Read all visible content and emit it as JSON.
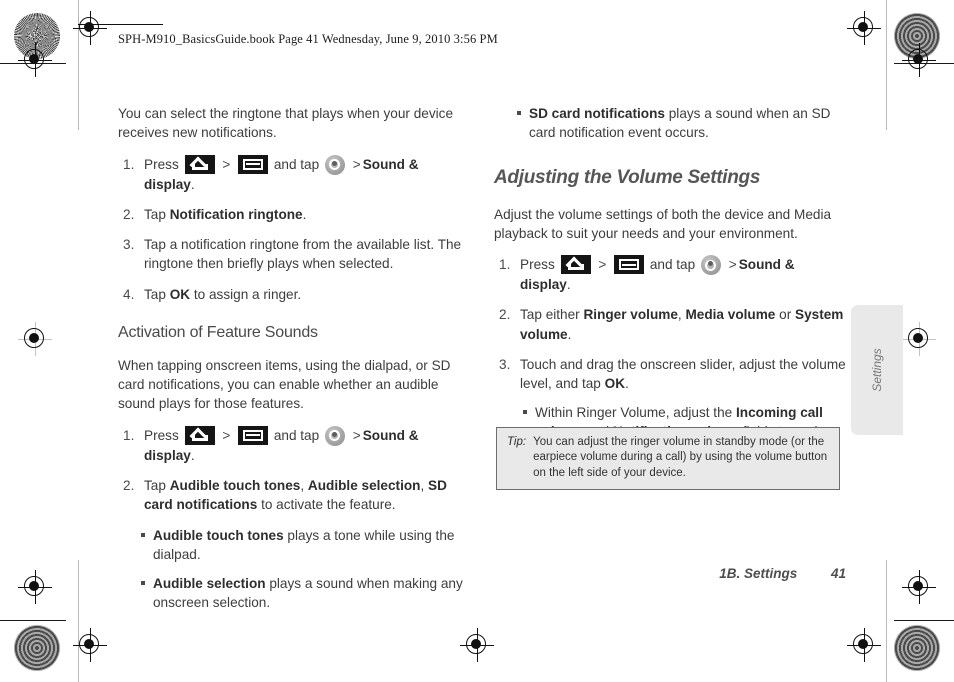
{
  "running_head": "SPH-M910_BasicsGuide.book  Page 41  Wednesday, June 9, 2010  3:56 PM",
  "colors": {
    "text": "#3d3d3d",
    "heading": "#4a4a4a",
    "tip_background": "#e9e9e9",
    "tip_border": "#6d6d6d",
    "tab_background": "#e9e9e9",
    "icon_black": "#151515"
  },
  "left_column": {
    "intro": "You can select the ringtone that plays when your device receives new notifications.",
    "steps": [
      {
        "pre": "Press",
        "mid": "and tap",
        "bold_tail": "Sound & display",
        "tail_period": "."
      },
      {
        "plain_pre": "Tap ",
        "bold": "Notification ringtone",
        "plain_post": "."
      },
      {
        "plain_only": "Tap a notification ringtone from the available list. The ringtone then briefly plays when selected."
      },
      {
        "plain_pre": "Tap ",
        "bold": "OK",
        "plain_post": " to assign a ringer."
      }
    ],
    "section_heading": "Activation of Feature Sounds",
    "section_intro": "When tapping onscreen items, using the dialpad, or SD card notifications, you can enable whether an audible sound plays for those features.",
    "section_steps": [
      {
        "pre": "Press",
        "mid": "and tap",
        "bold_tail": "Sound & display",
        "tail_period": "."
      },
      {
        "plain_pre": "Tap ",
        "bold_a": "Audible touch tones",
        "sep_a": ", ",
        "bold_b": "Audible selection",
        "sep_b": ", ",
        "bold_c": "SD card notifications",
        "plain_post": " to activate the feature."
      }
    ],
    "bullets": [
      {
        "bold": "Audible touch tones",
        "text": " plays a tone while using the dialpad."
      },
      {
        "bold": "Audible selection",
        "text": " plays a sound when making any onscreen selection."
      }
    ]
  },
  "right_column": {
    "lead_bullet": {
      "bold": "SD card notifications",
      "text": " plays a sound when an SD card notification event occurs."
    },
    "chapter_heading": "Adjusting the Volume Settings",
    "intro": "Adjust the volume settings of both the device and Media playback to suit your needs and your environment.",
    "steps": [
      {
        "pre": "Press",
        "mid": "and tap",
        "bold_tail": "Sound & display",
        "tail_period": "."
      },
      {
        "plain_pre": "Tap either ",
        "bold_a": "Ringer volume",
        "sep_a": ", ",
        "bold_b": "Media volume",
        "sep_b": " or ",
        "bold_c": "System volume",
        "plain_post": "."
      },
      {
        "plain_pre": "Touch and drag the onscreen slider, adjust the volume level, and tap ",
        "bold": "OK",
        "plain_post": "."
      }
    ],
    "sub_bullet": {
      "pre": "Within Ringer Volume, adjust the ",
      "bold_a": "Incoming call volume",
      "mid": " and ",
      "bold_b": "Notification volume",
      "post": " fields to assign the volume settings."
    }
  },
  "tip": {
    "label": "Tip:",
    "text": "You can adjust the ringer volume in standby mode (or the earpiece volume during a call) by using the volume button on the left side of your device."
  },
  "thumb_tab": {
    "label": "Settings"
  },
  "footer": {
    "chapter": "1B. Settings",
    "page_number": "41"
  },
  "icons": {
    "home": "home-key-icon",
    "menu": "menu-key-icon",
    "settings": "settings-gear-icon",
    "chevron": ">"
  }
}
